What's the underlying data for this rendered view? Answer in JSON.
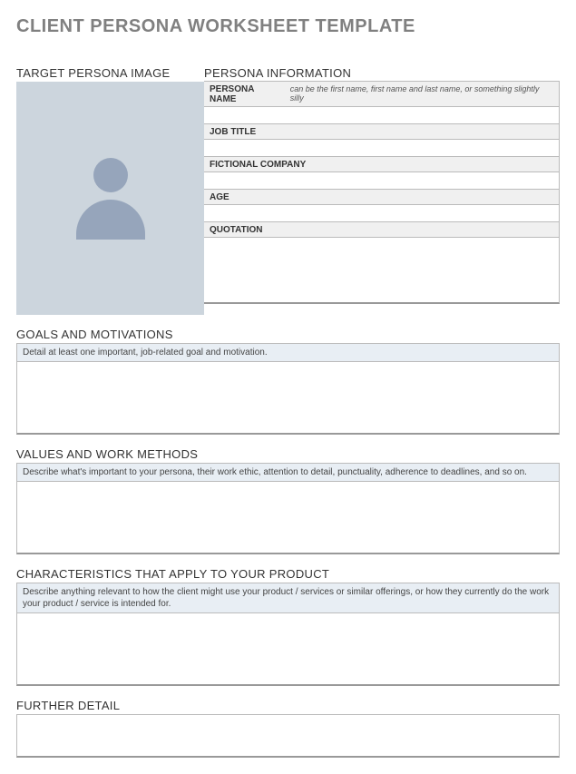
{
  "title": "CLIENT PERSONA WORKSHEET TEMPLATE",
  "imageSection": {
    "header": "TARGET PERSONA IMAGE"
  },
  "infoSection": {
    "header": "PERSONA INFORMATION",
    "fields": {
      "personaName": {
        "label": "PERSONA NAME",
        "hint": "can be the first name, first name and last name, or something slightly silly"
      },
      "jobTitle": {
        "label": "JOB TITLE"
      },
      "company": {
        "label": "FICTIONAL COMPANY"
      },
      "age": {
        "label": "AGE"
      },
      "quotation": {
        "label": "QUOTATION"
      }
    }
  },
  "goals": {
    "header": "GOALS AND MOTIVATIONS",
    "hint": "Detail at least one important, job-related goal and motivation."
  },
  "values": {
    "header": "VALUES AND WORK METHODS",
    "hint": "Describe what's important to your persona, their work ethic, attention to detail, punctuality, adherence to deadlines, and so on."
  },
  "characteristics": {
    "header": "CHARACTERISTICS THAT APPLY TO YOUR PRODUCT",
    "hint": "Describe anything relevant to how the client might use your product / services or similar offerings, or how they currently do the work your product / service is intended for."
  },
  "further": {
    "header": "FURTHER DETAIL"
  }
}
